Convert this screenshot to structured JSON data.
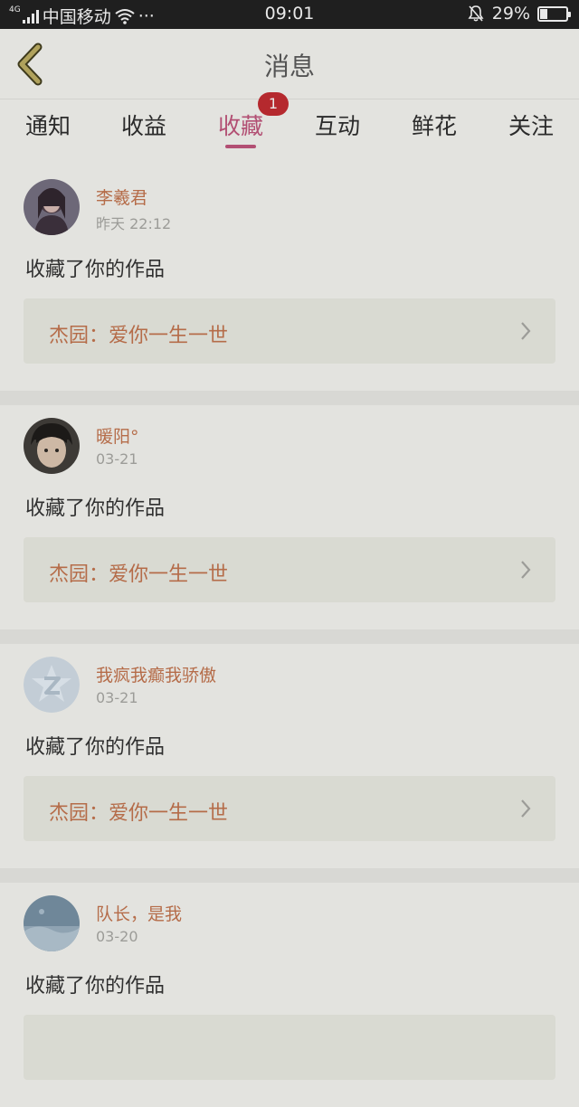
{
  "status_bar": {
    "network": "4G",
    "carrier": "中国移动",
    "dots": "···",
    "time": "09:01",
    "battery": "29%",
    "battery_level": 0.29
  },
  "header": {
    "title": "消息"
  },
  "tabs": [
    {
      "label": "通知"
    },
    {
      "label": "收益"
    },
    {
      "label": "收藏",
      "active": true,
      "badge": "1"
    },
    {
      "label": "互动"
    },
    {
      "label": "鲜花"
    },
    {
      "label": "关注"
    }
  ],
  "messages": [
    {
      "user": "李羲君",
      "time": "昨天 22:12",
      "action": "收藏了你的作品",
      "work": "杰园：爱你一生一世"
    },
    {
      "user": "暖阳°",
      "time": "03-21",
      "action": "收藏了你的作品",
      "work": "杰园：爱你一生一世"
    },
    {
      "user": "我疯我癫我骄傲",
      "time": "03-21",
      "action": "收藏了你的作品",
      "work": "杰园：爱你一生一世"
    },
    {
      "user": "队长，是我",
      "time": "03-20",
      "action": "收藏了你的作品",
      "work": ""
    }
  ],
  "colors": {
    "accent": "#b24f73",
    "name": "#b56c49",
    "badge": "#b5292e"
  }
}
